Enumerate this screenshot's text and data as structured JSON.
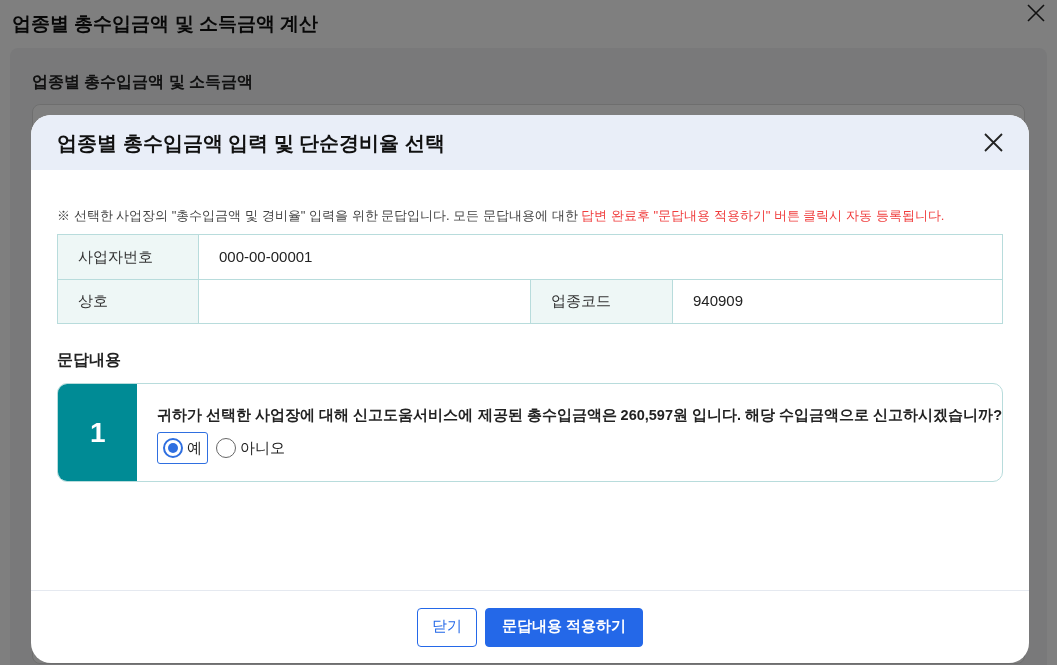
{
  "page": {
    "title": "업종별 총수입금액 및 소득금액 계산",
    "section_title": "업종별 총수입금액 및 소득금액"
  },
  "dialog": {
    "title": "업종별 총수입금액 입력 및 단순경비율 선택",
    "notice": {
      "text": "※ 선택한 사업장의 \"총수입금액 및 경비율\" 입력을 위한 문답입니다. 모든 문답내용에 대한 ",
      "highlight": "답변 완료후 \"문답내용 적용하기\" 버튼 클릭시 자동 등록됩니다."
    },
    "info": [
      {
        "label": "사업자번호",
        "value": "000-00-00001"
      },
      {
        "label": "상호"
      },
      {
        "label": "업종코드",
        "value": "940909"
      }
    ],
    "qa_title": "문답내용",
    "questions": [
      {
        "number": "1",
        "text": "귀하가 선택한 사업장에 대해 신고도움서비스에 제공된 총수입금액은 260,597원 입니다. 해당 수입금액으로 신고하시겠습니까?",
        "options": [
          {
            "label": "예",
            "selected": true
          },
          {
            "label": "아니오",
            "selected": false
          }
        ]
      }
    ],
    "buttons": [
      {
        "label": "닫기",
        "kind": "secondary"
      },
      {
        "label": "문답내용 적용하기",
        "kind": "primary"
      }
    ]
  }
}
